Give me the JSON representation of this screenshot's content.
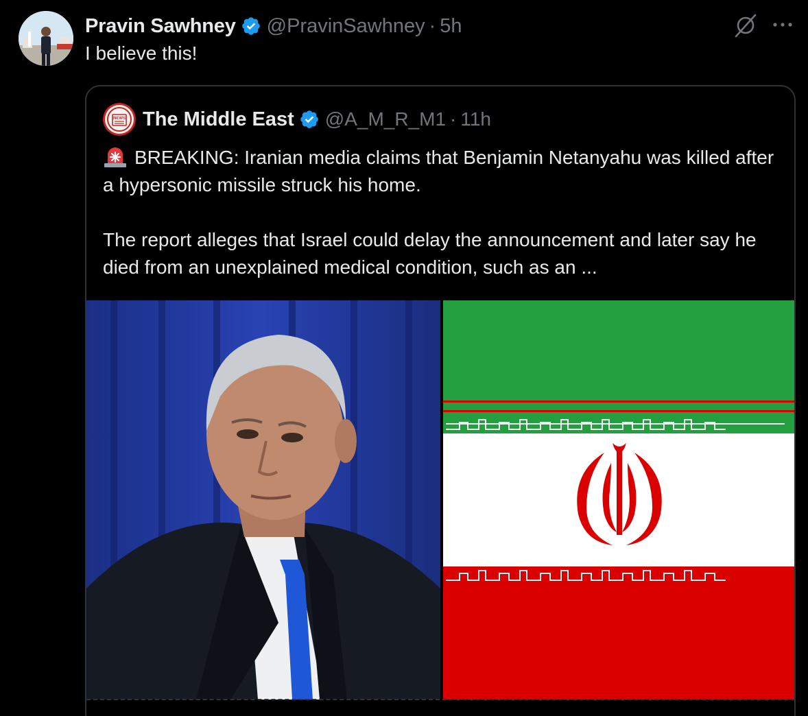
{
  "post": {
    "author_name": "Pravin Sawhney",
    "handle": "@PravinSawhney",
    "separator": "·",
    "time": "5h",
    "text": "I believe this!"
  },
  "quote": {
    "author_name": "The Middle East",
    "handle": "@A_M_R_M1",
    "separator": "·",
    "time": "11h",
    "paragraph1": "BREAKING: Iranian media claims that Benjamin Netanyahu was killed after a hypersonic missile struck his home.",
    "paragraph2": "The report alleges that Israel could delay the announcement and later say he died from an unexplained medical condition, such as an ...",
    "avatar_badge": "NEWS"
  },
  "icons": {
    "verified": "verified-badge-icon",
    "grok": "grok-icon",
    "more": "more-icon",
    "siren": "rotating-light-emoji"
  },
  "colors": {
    "background": "#000000",
    "text": "#e7e9ea",
    "secondary": "#71767b",
    "border": "#2f3336",
    "verified": "#1d9bf0",
    "flag_green": "#239f40",
    "flag_white": "#ffffff",
    "flag_red": "#da0000"
  }
}
